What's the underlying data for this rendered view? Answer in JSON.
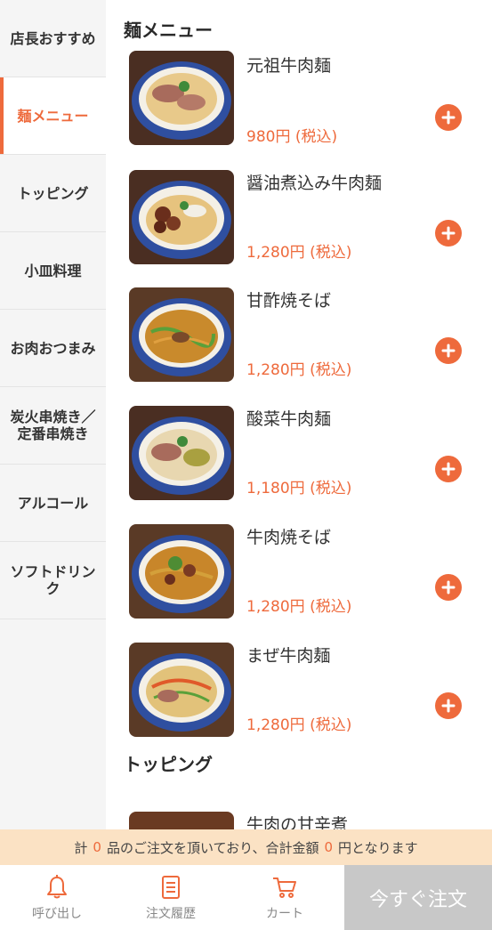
{
  "sidebar": {
    "categories": [
      {
        "label": "店長おすすめ"
      },
      {
        "label": "麺メニュー"
      },
      {
        "label": "トッピング"
      },
      {
        "label": "小皿料理"
      },
      {
        "label": "お肉おつまみ"
      },
      {
        "label": "炭火串焼き／定番串焼き"
      },
      {
        "label": "アルコール"
      },
      {
        "label": "ソフトドリンク"
      }
    ],
    "active_index": 1
  },
  "sections": [
    {
      "title": "麺メニュー",
      "items": [
        {
          "name": "元祖牛肉麺",
          "price": "980円 (税込)"
        },
        {
          "name": "醤油煮込み牛肉麺",
          "price": "1,280円 (税込)"
        },
        {
          "name": "甘酢焼そば",
          "price": "1,280円 (税込)"
        },
        {
          "name": "酸菜牛肉麺",
          "price": "1,180円 (税込)"
        },
        {
          "name": "牛肉焼そば",
          "price": "1,280円 (税込)"
        },
        {
          "name": "まぜ牛肉麺",
          "price": "1,280円 (税込)"
        }
      ]
    },
    {
      "title": "トッピング",
      "items": [
        {
          "name": "牛肉の甘辛煮",
          "price": ""
        }
      ]
    }
  ],
  "summary": {
    "prefix": "計",
    "item_count": "0",
    "middle": "品のご注文を頂いており、合計金額",
    "total": "0",
    "suffix": "円となります"
  },
  "bottom_nav": {
    "call": {
      "label": "呼び出し",
      "icon": "bell-icon"
    },
    "history": {
      "label": "注文履歴",
      "icon": "list-icon"
    },
    "cart": {
      "label": "カート",
      "icon": "cart-icon"
    },
    "order_now": {
      "label": "今すぐ注文"
    }
  },
  "colors": {
    "accent": "#ee6a3c",
    "summary_bg": "#fbe2c4",
    "sidebar_bg": "#f5f5f5",
    "order_button_bg": "#c8c8c8"
  }
}
